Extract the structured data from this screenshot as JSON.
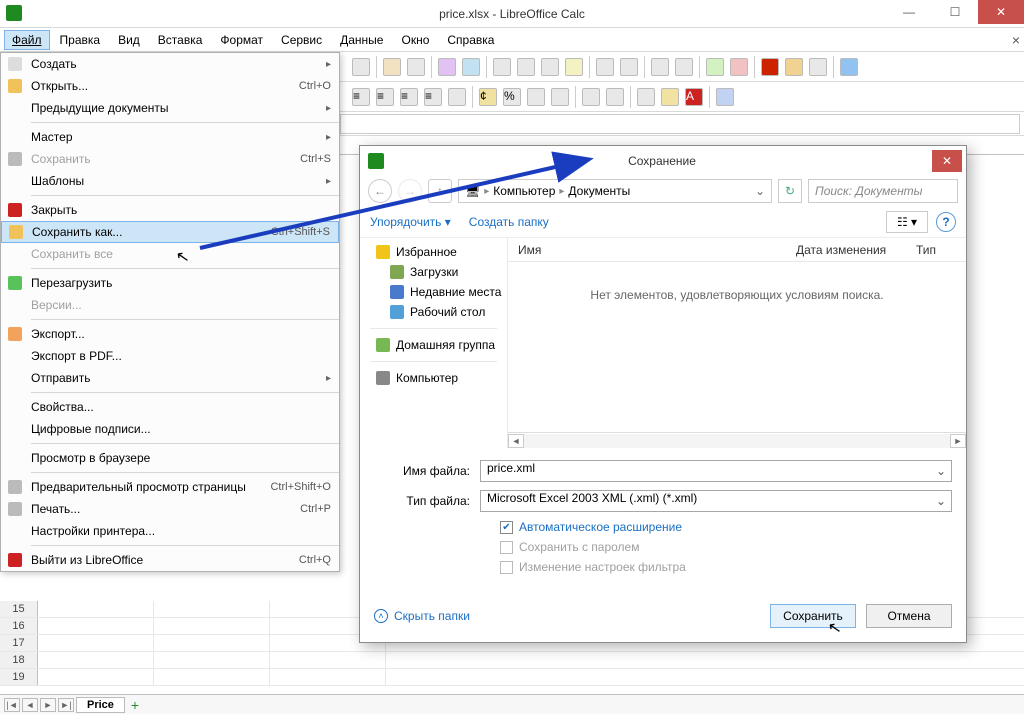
{
  "window": {
    "title": "price.xlsx - LibreOffice Calc"
  },
  "menubar": {
    "items": [
      "Файл",
      "Правка",
      "Вид",
      "Вставка",
      "Формат",
      "Сервис",
      "Данные",
      "Окно",
      "Справка"
    ]
  },
  "file_menu": {
    "items": [
      {
        "label": "Создать",
        "submenu": true
      },
      {
        "label": "Открыть...",
        "shortcut": "Ctrl+O"
      },
      {
        "label": "Предыдущие документы",
        "submenu": true
      },
      {
        "sep": true
      },
      {
        "label": "Мастер",
        "submenu": true
      },
      {
        "label": "Сохранить",
        "disabled": true,
        "shortcut": "Ctrl+S"
      },
      {
        "label": "Шаблоны",
        "submenu": true
      },
      {
        "sep": true
      },
      {
        "label": "Закрыть"
      },
      {
        "label": "Сохранить как...",
        "shortcut": "Ctrl+Shift+S",
        "highlight": true
      },
      {
        "label": "Сохранить все",
        "disabled": true
      },
      {
        "sep": true
      },
      {
        "label": "Перезагрузить"
      },
      {
        "label": "Версии...",
        "disabled": true
      },
      {
        "sep": true
      },
      {
        "label": "Экспорт..."
      },
      {
        "label": "Экспорт в PDF..."
      },
      {
        "label": "Отправить",
        "submenu": true
      },
      {
        "sep": true
      },
      {
        "label": "Свойства..."
      },
      {
        "label": "Цифровые подписи..."
      },
      {
        "sep": true
      },
      {
        "label": "Просмотр в браузере"
      },
      {
        "sep": true
      },
      {
        "label": "Предварительный просмотр страницы",
        "shortcut": "Ctrl+Shift+O"
      },
      {
        "label": "Печать...",
        "shortcut": "Ctrl+P"
      },
      {
        "label": "Настройки принтера..."
      },
      {
        "sep": true
      },
      {
        "label": "Выйти из LibreOffice",
        "shortcut": "Ctrl+Q"
      }
    ]
  },
  "save_dialog": {
    "title": "Сохранение",
    "crumb1": "Компьютер",
    "crumb2": "Документы",
    "search_placeholder": "Поиск: Документы",
    "organize": "Упорядочить",
    "new_folder": "Создать папку",
    "tree": {
      "fav": "Избранное",
      "downloads": "Загрузки",
      "recent": "Недавние места",
      "desktop": "Рабочий стол",
      "homegroup": "Домашняя группа",
      "computer": "Компьютер"
    },
    "cols": {
      "name": "Имя",
      "date": "Дата изменения",
      "type": "Тип"
    },
    "empty_msg": "Нет элементов, удовлетворяющих условиям поиска.",
    "filename_label": "Имя файла:",
    "filename_value": "price.xml",
    "filetype_label": "Тип файла:",
    "filetype_value": "Microsoft Excel 2003 XML (.xml) (*.xml)",
    "opt_autoext": "Автоматическое расширение",
    "opt_password": "Сохранить с паролем",
    "opt_filter": "Изменение настроек фильтра",
    "hide_folders": "Скрыть папки",
    "btn_save": "Сохранить",
    "btn_cancel": "Отмена"
  },
  "sheet": {
    "tab_name": "Price",
    "visible_rows": [
      "15",
      "16",
      "17",
      "18",
      "19"
    ]
  }
}
